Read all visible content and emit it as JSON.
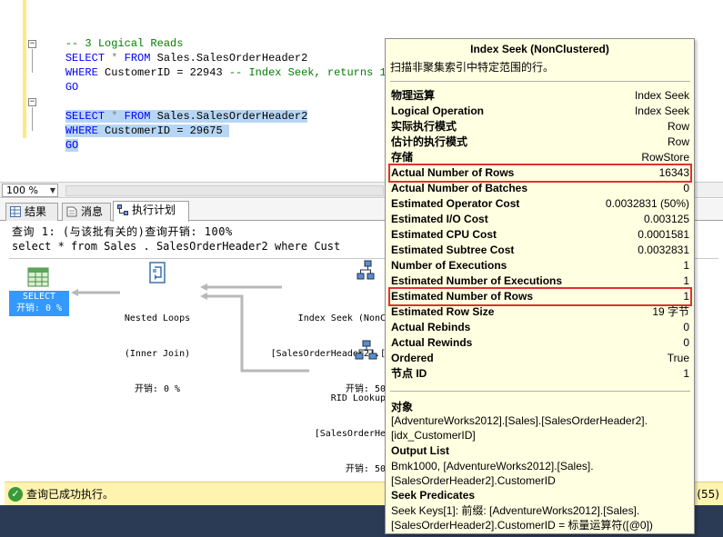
{
  "editor": {
    "lines": [
      {
        "text": "-- 3 Logical Reads"
      },
      {
        "kw1": "SELECT",
        "mid1": " * ",
        "kw2": "FROM",
        "rest": " Sales.SalesOrderHeader2"
      },
      {
        "kw1": "WHERE",
        "rest": " CustomerID = 22943 ",
        "comment": "-- Index Seek, returns 1 reco"
      },
      {
        "kw1": "GO"
      },
      {
        "kw1": "SELECT",
        "mid1": " * ",
        "kw2": "FROM",
        "rest": " Sales.SalesOrderHeader2"
      },
      {
        "kw1": "WHERE",
        "rest": " CustomerID = 29675"
      },
      {
        "kw1": "GO"
      }
    ]
  },
  "zoom": {
    "value": "100 %"
  },
  "tabs": [
    {
      "label": "结果"
    },
    {
      "label": "消息"
    },
    {
      "label": "执行计划"
    }
  ],
  "plan": {
    "query_line": "查询 1: (与该批有关的)查询开销: 100%",
    "sql_line": "select * from Sales . SalesOrderHeader2 where Cust",
    "select_op": {
      "name": "SELECT",
      "cost": "开销: 0 %"
    },
    "nested_loops": {
      "name": "Nested Loops",
      "sub": "(Inner Join)",
      "cost": "开销: 0 %"
    },
    "index_seek": {
      "name": "Index Seek (NonC",
      "sub": "[SalesOrderHeader2].[",
      "cost": "开销: 50"
    },
    "rid_lookup": {
      "name": "RID Lookup",
      "sub": "[SalesOrderHe",
      "cost": "开销: 50"
    }
  },
  "status": {
    "text": "查询已成功执行。",
    "right": "a (55)"
  },
  "tooltip": {
    "title": "Index Seek (NonClustered)",
    "description": "扫描非聚集索引中特定范围的行。",
    "rows": [
      {
        "k": "物理运算",
        "v": "Index Seek"
      },
      {
        "k": "Logical Operation",
        "v": "Index Seek"
      },
      {
        "k": "实际执行模式",
        "v": "Row"
      },
      {
        "k": "估计的执行模式",
        "v": "Row"
      },
      {
        "k": "存储",
        "v": "RowStore"
      },
      {
        "k": "Actual Number of Rows",
        "v": "16343"
      },
      {
        "k": "Actual Number of Batches",
        "v": "0"
      },
      {
        "k": "Estimated Operator Cost",
        "v": "0.0032831 (50%)"
      },
      {
        "k": "Estimated I/O Cost",
        "v": "0.003125"
      },
      {
        "k": "Estimated CPU Cost",
        "v": "0.0001581"
      },
      {
        "k": "Estimated Subtree Cost",
        "v": "0.0032831"
      },
      {
        "k": "Number of Executions",
        "v": "1"
      },
      {
        "k": "Estimated Number of Executions",
        "v": "1"
      },
      {
        "k": "Estimated Number of Rows",
        "v": "1"
      },
      {
        "k": "Estimated Row Size",
        "v": "19 字节"
      },
      {
        "k": "Actual Rebinds",
        "v": "0"
      },
      {
        "k": "Actual Rewinds",
        "v": "0"
      },
      {
        "k": "Ordered",
        "v": "True"
      },
      {
        "k": "节点 ID",
        "v": "1"
      }
    ],
    "object_head": "对象",
    "object_text": "[AdventureWorks2012].[Sales].[SalesOrderHeader2].\n[idx_CustomerID]",
    "output_head": "Output List",
    "output_text": "Bmk1000, [AdventureWorks2012].[Sales].\n[SalesOrderHeader2].CustomerID",
    "seek_head": "Seek Predicates",
    "seek_text": "Seek Keys[1]: 前缀: [AdventureWorks2012].[Sales].\n[SalesOrderHeader2].CustomerID = 标量运算符([@0])"
  }
}
